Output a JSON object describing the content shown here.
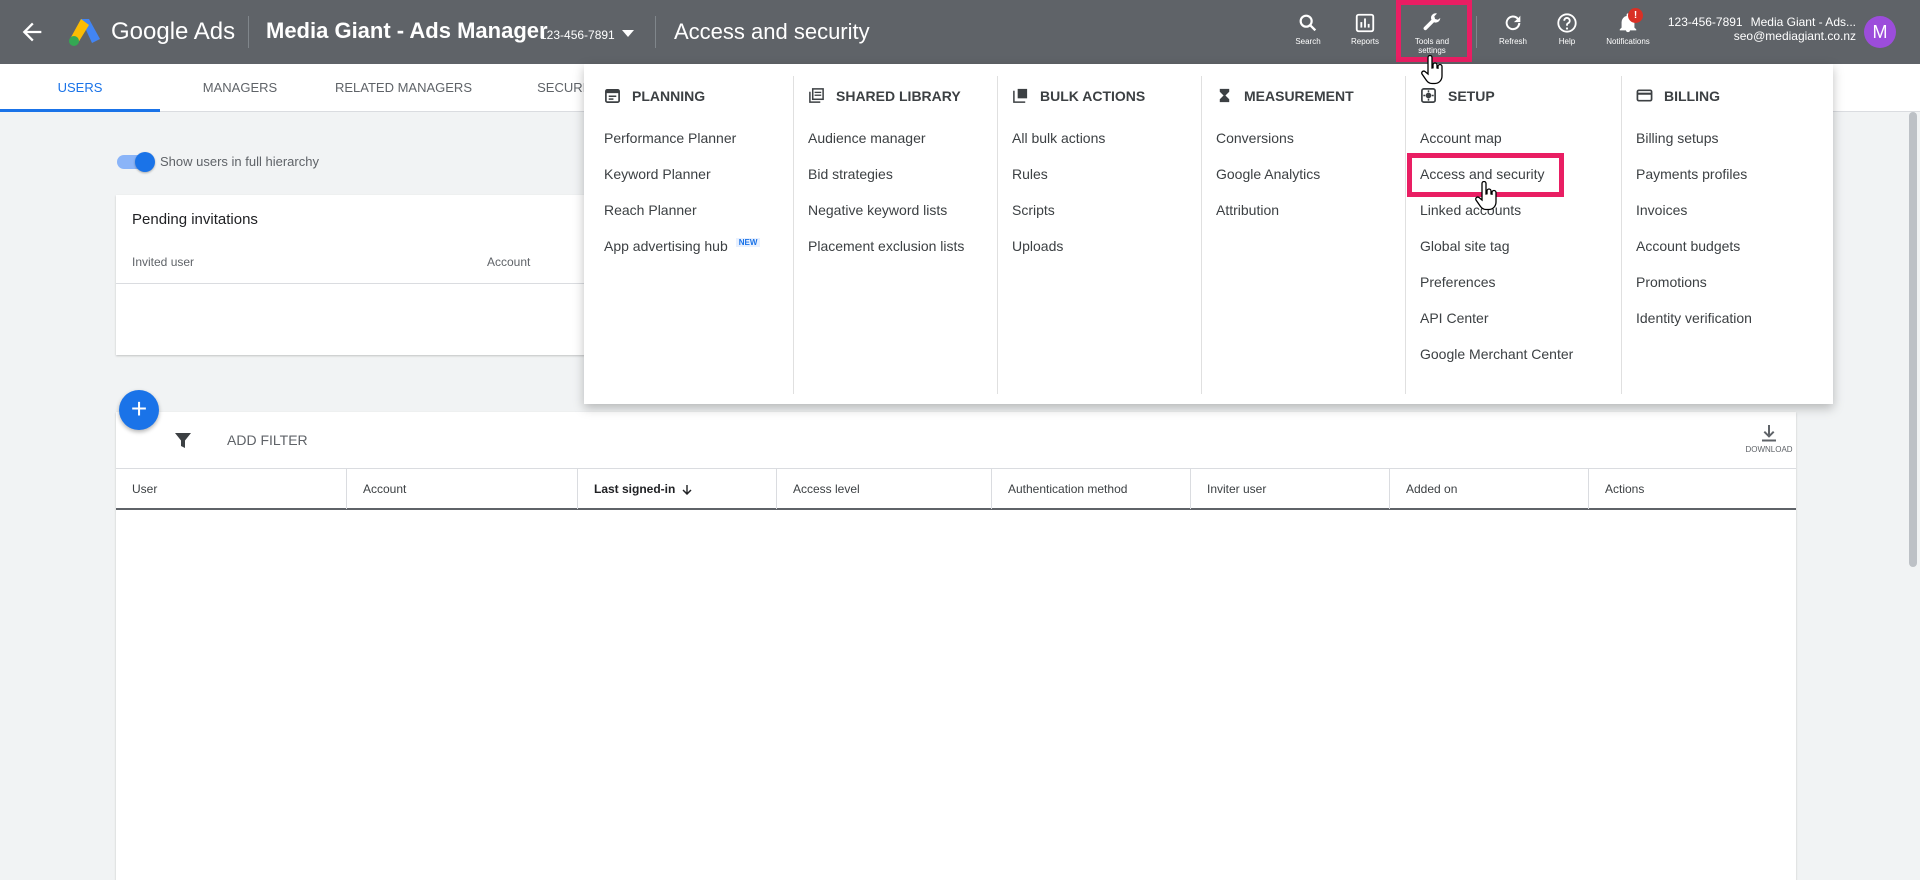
{
  "header": {
    "brand": "Google Ads",
    "account_name": "Media Giant - Ads Manager",
    "account_id": "123-456-7891",
    "page_title": "Access and security",
    "icons": [
      {
        "name": "search-icon",
        "label": "Search"
      },
      {
        "name": "reports-icon",
        "label": "Reports"
      },
      {
        "name": "tools-icon",
        "label": "Tools and settings"
      },
      {
        "name": "refresh-icon",
        "label": "Refresh"
      },
      {
        "name": "help-icon",
        "label": "Help"
      },
      {
        "name": "notifications-icon",
        "label": "Notifications"
      }
    ],
    "notification_badge": "!",
    "right_account_id": "123-456-7891",
    "right_account_name": "Media Giant - Ads...",
    "user_email": "seo@mediagiant.co.nz",
    "avatar_letter": "M"
  },
  "tabs": [
    "USERS",
    "MANAGERS",
    "RELATED MANAGERS",
    "SECURITY"
  ],
  "toggle": {
    "label": "Show users in full hierarchy",
    "on": true
  },
  "pending": {
    "title": "Pending invitations",
    "columns": [
      "Invited user",
      "Account"
    ]
  },
  "table": {
    "add_filter": "ADD FILTER",
    "download": "DOWNLOAD",
    "columns": [
      "User",
      "Account",
      "Last signed-in",
      "Access level",
      "Authentication method",
      "Inviter user",
      "Added on",
      "Actions"
    ]
  },
  "menu": {
    "columns": [
      {
        "heading": "PLANNING",
        "icon": "planning-icon",
        "items": [
          "Performance Planner",
          "Keyword Planner",
          "Reach Planner",
          "App advertising hub"
        ]
      },
      {
        "heading": "SHARED LIBRARY",
        "icon": "library-icon",
        "items": [
          "Audience manager",
          "Bid strategies",
          "Negative keyword lists",
          "Placement exclusion lists"
        ]
      },
      {
        "heading": "BULK ACTIONS",
        "icon": "bulk-actions-icon",
        "items": [
          "All bulk actions",
          "Rules",
          "Scripts",
          "Uploads"
        ]
      },
      {
        "heading": "MEASUREMENT",
        "icon": "measurement-icon",
        "items": [
          "Conversions",
          "Google Analytics",
          "Attribution"
        ]
      },
      {
        "heading": "SETUP",
        "icon": "setup-icon",
        "items": [
          "Account map",
          "Access and security",
          "Linked accounts",
          "Global site tag",
          "Preferences",
          "API Center",
          "Google Merchant Center"
        ]
      },
      {
        "heading": "BILLING",
        "icon": "billing-icon",
        "items": [
          "Billing setups",
          "Payments profiles",
          "Invoices",
          "Account budgets",
          "Promotions",
          "Identity verification"
        ]
      }
    ],
    "new_badge": "NEW"
  },
  "colors": {
    "topbar": "#5f6368",
    "accent": "#1a73e8",
    "highlight": "#e91e63",
    "avatar": "#9c4ddb"
  }
}
